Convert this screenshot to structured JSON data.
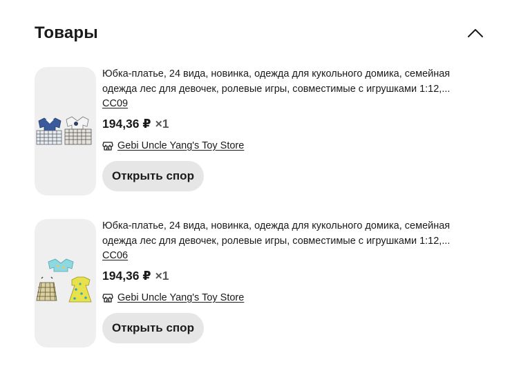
{
  "section": {
    "title": "Товары",
    "collapse_icon": "chevron-up-icon"
  },
  "products": [
    {
      "title": "Юбка-платье, 24 вида, новинка, одежда для кукольного домика, семейная одежда лес для девочек, ролевые игры, совместимые с игрушками 1:12,...",
      "variant": "CC09",
      "price": "194,36 ₽",
      "quantity": "×1",
      "store_icon": "store-icon",
      "store": "Gebi Uncle Yang's Toy Store",
      "button": "Открыть спор"
    },
    {
      "title": "Юбка-платье, 24 вида, новинка, одежда для кукольного домика, семейная одежда лес для девочек, ролевые игры, совместимые с игрушками 1:12,...",
      "variant": "CC06",
      "price": "194,36 ₽",
      "quantity": "×1",
      "store_icon": "store-icon",
      "store": "Gebi Uncle Yang's Toy Store",
      "button": "Открыть спор"
    }
  ]
}
